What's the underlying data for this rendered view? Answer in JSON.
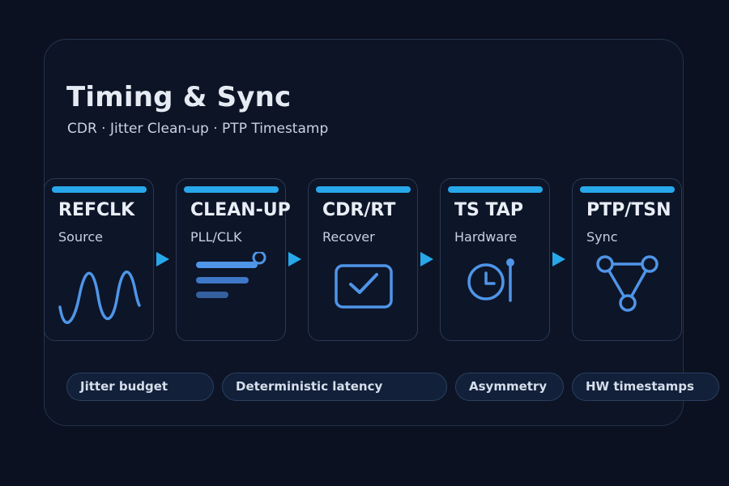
{
  "header": {
    "title": "Timing & Sync",
    "subtitle": "CDR · Jitter Clean-up · PTP Timestamp"
  },
  "stages": [
    {
      "name": "REFCLK",
      "sub": "Source",
      "icon": "sine-wave-icon"
    },
    {
      "name": "CLEAN-UP",
      "sub": "PLL/CLK",
      "icon": "filter-bars-icon"
    },
    {
      "name": "CDR/RT",
      "sub": "Recover",
      "icon": "checkbox-icon"
    },
    {
      "name": "TS TAP",
      "sub": "Hardware",
      "icon": "clock-probe-icon"
    },
    {
      "name": "PTP/TSN",
      "sub": "Sync",
      "icon": "network-triangle-icon"
    }
  ],
  "tags": [
    "Jitter budget",
    "Deterministic latency",
    "Asymmetry",
    "HW timestamps"
  ],
  "colors": {
    "background": "#0b1120",
    "accent": "#27a8ea",
    "icon": "#4f95e8",
    "text": "#e9eef6"
  }
}
